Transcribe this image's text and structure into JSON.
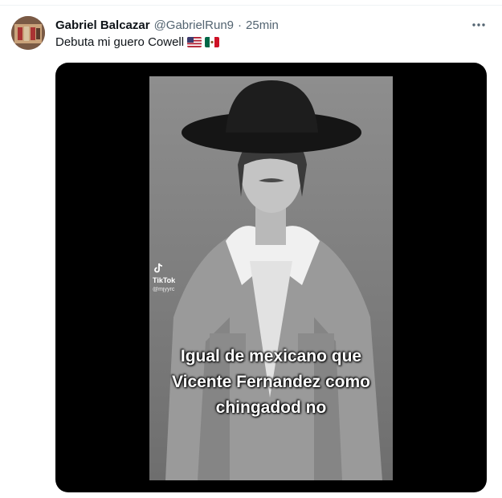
{
  "tweet": {
    "display_name": "Gabriel Balcazar",
    "handle": "@GabrielRun9",
    "separator": "·",
    "time": "25min",
    "text": "Debuta mi guero Cowell",
    "flags": [
      "us-flag-icon",
      "mexico-flag-icon"
    ]
  },
  "media": {
    "watermark": {
      "brand": "TikTok",
      "user": "@mjyyrc"
    },
    "caption": "Igual de mexicano que\nVicente Fernandez como\nchingadod no"
  },
  "colors": {
    "text": "#0f1419",
    "secondary": "#536471",
    "media_bg": "#000000"
  }
}
